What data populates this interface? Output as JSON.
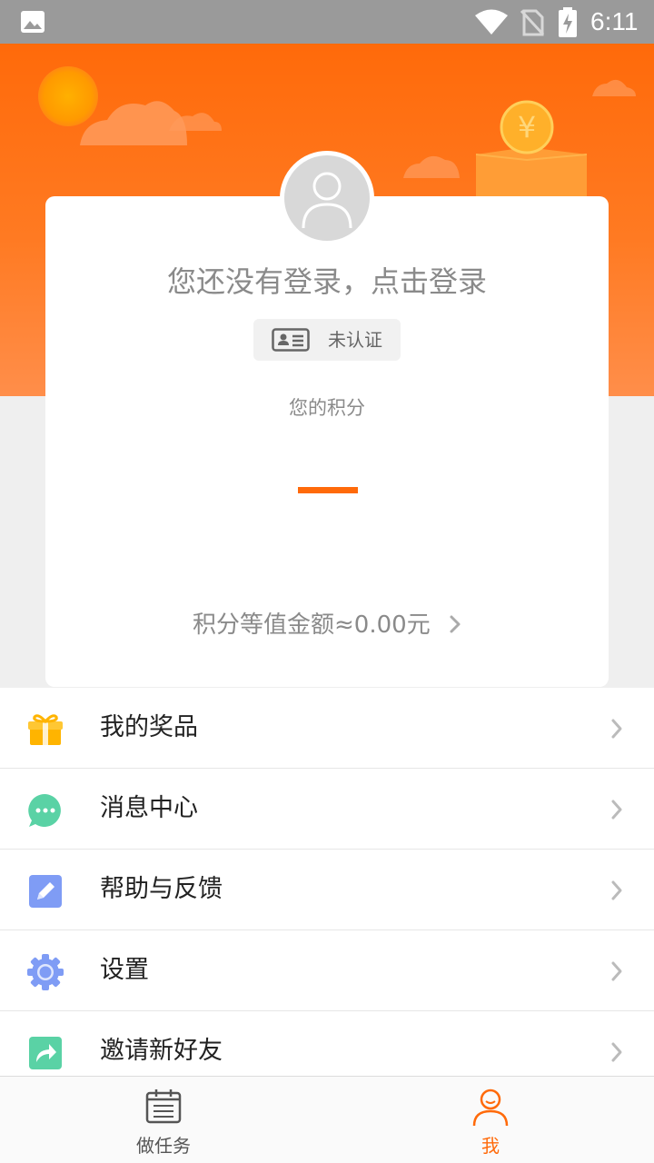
{
  "status_bar": {
    "time": "6:11",
    "icons": [
      "gallery-icon",
      "wifi-icon",
      "no-sim-icon",
      "battery-charging-icon"
    ]
  },
  "profile": {
    "login_prompt": "您还没有登录，点击登录",
    "verify_status": "未认证",
    "points_label": "您的积分",
    "points_value": "—",
    "points_equivalent": "积分等值金额≈0.00元"
  },
  "menu": {
    "items": [
      {
        "label": "我的奖品",
        "icon": "gift-icon",
        "color": "#ffb400"
      },
      {
        "label": "消息中心",
        "icon": "message-icon",
        "color": "#5ad2a5"
      },
      {
        "label": "帮助与反馈",
        "icon": "edit-icon",
        "color": "#7f9cf5"
      },
      {
        "label": "设置",
        "icon": "gear-icon",
        "color": "#7f9cf5"
      },
      {
        "label": "邀请新好友",
        "icon": "share-icon",
        "color": "#5ad2a5"
      }
    ]
  },
  "bottom_nav": {
    "tabs": [
      {
        "label": "做任务",
        "icon": "calendar-icon",
        "active": false
      },
      {
        "label": "我",
        "icon": "person-icon",
        "active": true
      }
    ]
  },
  "colors": {
    "accent": "#ff6a0a",
    "header_top": "#ff6a0a",
    "header_bottom": "#ff8e4a",
    "text_secondary": "#8a8a8a",
    "inactive_tab": "#555555"
  }
}
